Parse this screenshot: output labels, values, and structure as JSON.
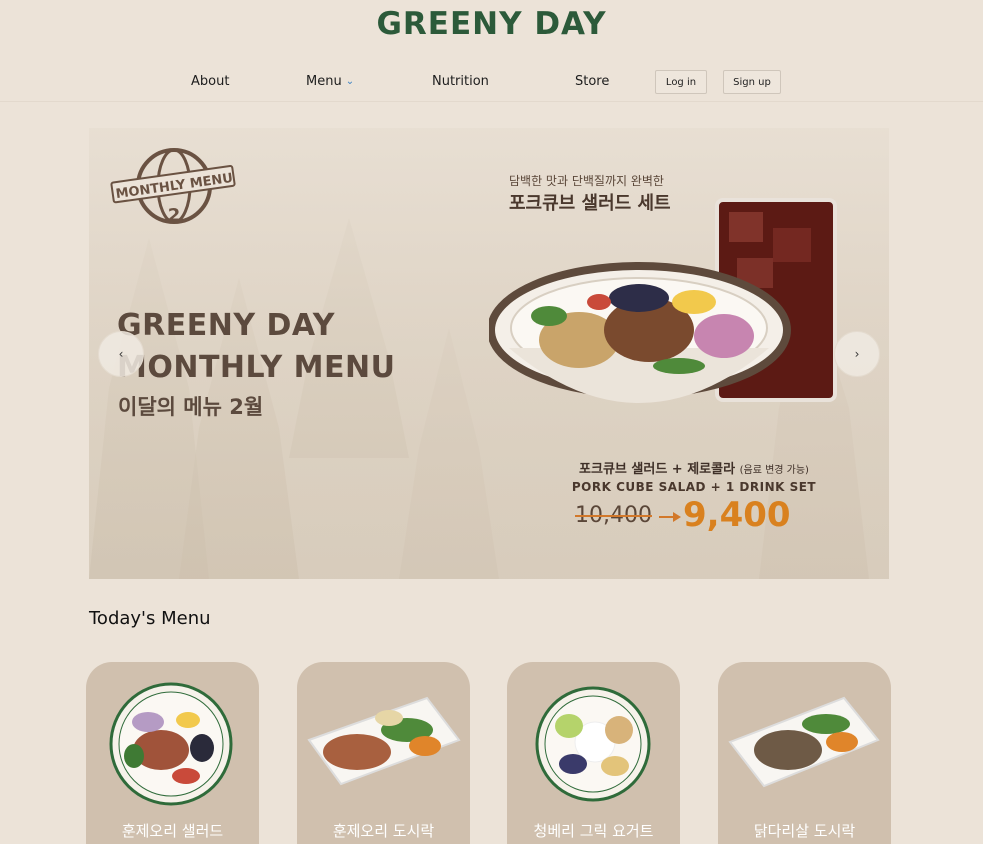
{
  "header": {
    "brand": "GREENY DAY",
    "nav": [
      "About",
      "Menu",
      "Nutrition",
      "Store"
    ],
    "menu_chevron_icon": "chevron-down-icon",
    "login_label": "Log in",
    "signup_label": "Sign up"
  },
  "banner": {
    "badge": {
      "line1": "MONTHLY MENU",
      "number": "2"
    },
    "headline_line1": "GREENY DAY",
    "headline_line2": "MONTHLY MENU",
    "sub_korean": "이달의 메뉴 2월",
    "promo_small": "담백한 맛과 단백질까지 완벽한",
    "promo_title": "포크큐브 샐러드 세트",
    "offer_korean": "포크큐브 샐러드 + 제로콜라",
    "offer_note": "(음료 변경 가능)",
    "offer_english": "PORK CUBE SALAD + 1 DRINK SET",
    "old_price": "10,400",
    "new_price": "9,400",
    "prev_label": "‹",
    "next_label": "›"
  },
  "today": {
    "title": "Today's Menu",
    "items": [
      {
        "label": "훈제오리 샐러드"
      },
      {
        "label": "훈제오리 도시락"
      },
      {
        "label": "청베리 그릭 요거트"
      },
      {
        "label": "닭다리살 도시락"
      }
    ]
  },
  "colors": {
    "background": "#ece3d8",
    "brand": "#2c5a3a",
    "price_accent": "#d9811f",
    "card": "#d0c0ae"
  }
}
